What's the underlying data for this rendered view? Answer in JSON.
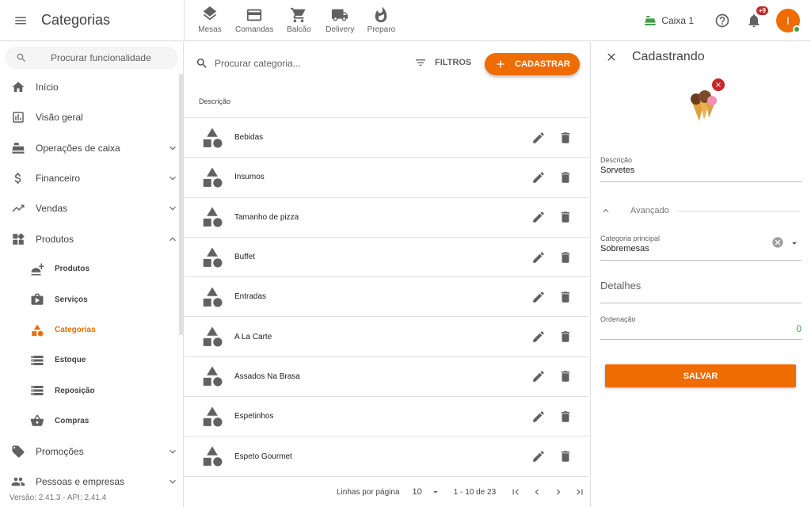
{
  "app": {
    "title": "Categorias"
  },
  "topnav": [
    {
      "label": "Mesas",
      "icon": "layers-icon"
    },
    {
      "label": "Comandas",
      "icon": "card-icon"
    },
    {
      "label": "Balcão",
      "icon": "cart-icon"
    },
    {
      "label": "Delivery",
      "icon": "truck-icon"
    },
    {
      "label": "Preparo",
      "icon": "fire-icon"
    }
  ],
  "header": {
    "caixa": "Caixa 1",
    "notifications": "+9",
    "avatar_initial": "I"
  },
  "sidebar": {
    "search_placeholder": "Procurar funcionalidade",
    "items": [
      {
        "label": "Início"
      },
      {
        "label": "Visão geral"
      },
      {
        "label": "Operações de caixa"
      },
      {
        "label": "Financeiro"
      },
      {
        "label": "Vendas"
      },
      {
        "label": "Produtos"
      },
      {
        "label": "Produtos"
      },
      {
        "label": "Serviços"
      },
      {
        "label": "Categorias"
      },
      {
        "label": "Estoque"
      },
      {
        "label": "Reposição"
      },
      {
        "label": "Compras"
      },
      {
        "label": "Promoções"
      },
      {
        "label": "Pessoas e empresas"
      }
    ],
    "version": "Versão: 2.41.3 - API: 2.41.4"
  },
  "main": {
    "search_placeholder": "Procurar categoria...",
    "filters_label": "FILTROS",
    "add_label": "CADASTRAR",
    "column_header": "Descrição",
    "rows": [
      "Bebidas",
      "Insumos",
      "Tamanho de pizza",
      "Buffet",
      "Entradas",
      "A La Carte",
      "Assados Na Brasa",
      "Espetinhos",
      "Espeto Gourmet"
    ],
    "pager": {
      "rows_per_page_label": "Linhas por página",
      "rows_per_page": "10",
      "range": "1 - 10 de 23"
    }
  },
  "panel": {
    "title": "Cadastrando",
    "descricao_label": "Descrição",
    "descricao_value": "Sorvetes",
    "avancado_label": "Avançado",
    "categoria_label": "Categoria principal",
    "categoria_value": "Sobremesas",
    "detalhes_placeholder": "Detalhes",
    "ordenacao_label": "Ordenação",
    "ordenacao_value": "0",
    "save_label": "SALVAR"
  },
  "colors": {
    "accent": "#ef6c00",
    "success": "#43a047",
    "danger": "#c62828"
  }
}
